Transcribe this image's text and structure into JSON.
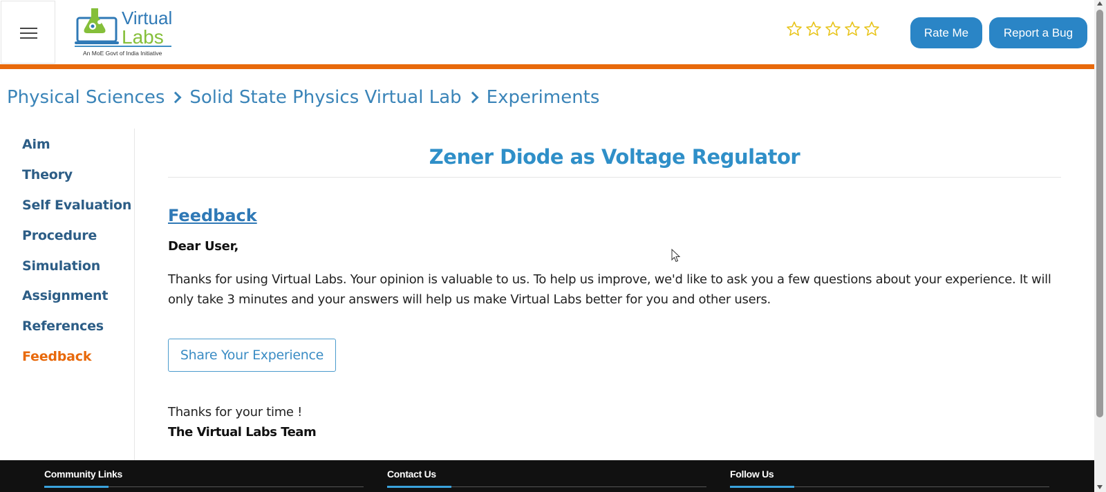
{
  "header": {
    "logo": {
      "word1": "Virtual",
      "word2": "Labs",
      "tagline": "An MoE Govt of India Initiative"
    },
    "rating_stars": 0,
    "rate_button": "Rate Me",
    "bug_button": "Report a Bug"
  },
  "breadcrumb": [
    "Physical Sciences",
    "Solid State Physics Virtual Lab",
    "Experiments"
  ],
  "sidebar": {
    "items": [
      {
        "label": "Aim"
      },
      {
        "label": "Theory"
      },
      {
        "label": "Self Evaluation"
      },
      {
        "label": "Procedure"
      },
      {
        "label": "Simulation"
      },
      {
        "label": "Assignment"
      },
      {
        "label": "References"
      },
      {
        "label": "Feedback"
      }
    ],
    "active_index": 7
  },
  "main": {
    "title": "Zener Diode as Voltage Regulator",
    "feedback_heading": "Feedback",
    "greeting": "Dear User,",
    "paragraph": "Thanks for using Virtual Labs. Your opinion is valuable to us. To help us improve, we'd like to ask you a few questions about your experience. It will only take 3 minutes and your answers will help us make Virtual Labs better for you and other users.",
    "share_button": "Share Your Experience",
    "thanks": "Thanks for your time !",
    "signature": "The Virtual Labs Team"
  },
  "footer": {
    "columns": [
      "Community Links",
      "Contact Us",
      "Follow Us"
    ]
  },
  "colors": {
    "accent_orange": "#e8690b",
    "primary_blue": "#2a85c6",
    "link_blue": "#3a84b8",
    "star_gold": "#e8c41a",
    "footer_accent": "#3aa3dc"
  }
}
